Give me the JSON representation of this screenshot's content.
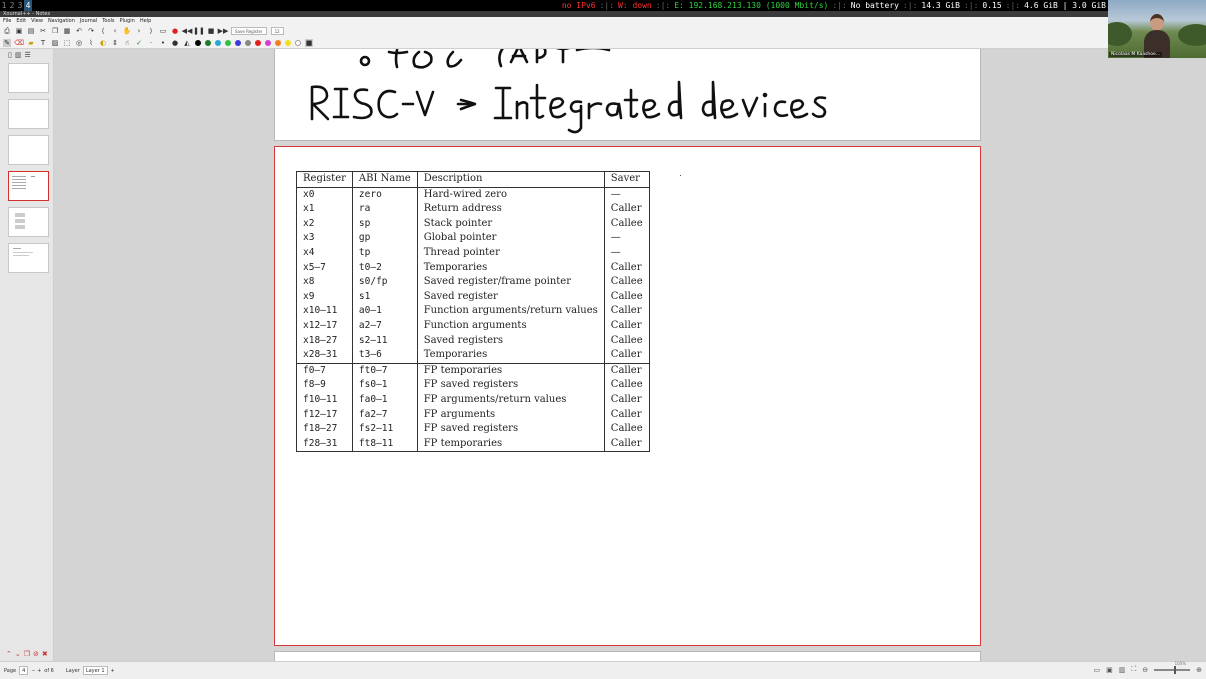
{
  "statusbar": {
    "workspaces": [
      "1",
      "2",
      "3",
      "4"
    ],
    "active_workspace": "4",
    "ipv6": "no IPv6",
    "wifi": "W: down",
    "ethernet": "E: 192.168.213.130 (1000 Mbit/s)",
    "battery": "No battery",
    "disk": "14.3 GiB",
    "load": "0.15",
    "memory": "4.6 GiB | 3.0 GiB"
  },
  "window": {
    "title": "Xournal++ - Notes"
  },
  "menu": [
    "File",
    "Edit",
    "View",
    "Navigation",
    "Journal",
    "Tools",
    "Plugin",
    "Help"
  ],
  "toolbar": {
    "layer_combo": "Save Register",
    "layer_num": "12"
  },
  "ink_text": {
    "line1": "• iOS (API",
    "line2": "RISC-V → Integrated devices"
  },
  "register_table": {
    "headers": [
      "Register",
      "ABI Name",
      "Description",
      "Saver"
    ],
    "rows": [
      [
        "x0",
        "zero",
        "Hard-wired zero",
        "—"
      ],
      [
        "x1",
        "ra",
        "Return address",
        "Caller"
      ],
      [
        "x2",
        "sp",
        "Stack pointer",
        "Callee"
      ],
      [
        "x3",
        "gp",
        "Global pointer",
        "—"
      ],
      [
        "x4",
        "tp",
        "Thread pointer",
        "—"
      ],
      [
        "x5–7",
        "t0–2",
        "Temporaries",
        "Caller"
      ],
      [
        "x8",
        "s0/fp",
        "Saved register/frame pointer",
        "Callee"
      ],
      [
        "x9",
        "s1",
        "Saved register",
        "Callee"
      ],
      [
        "x10–11",
        "a0–1",
        "Function arguments/return values",
        "Caller"
      ],
      [
        "x12–17",
        "a2–7",
        "Function arguments",
        "Caller"
      ],
      [
        "x18–27",
        "s2–11",
        "Saved registers",
        "Callee"
      ],
      [
        "x28–31",
        "t3–6",
        "Temporaries",
        "Caller"
      ],
      [
        "f0–7",
        "ft0–7",
        "FP temporaries",
        "Caller"
      ],
      [
        "f8–9",
        "fs0–1",
        "FP saved registers",
        "Callee"
      ],
      [
        "f10–11",
        "fa0–1",
        "FP arguments/return values",
        "Caller"
      ],
      [
        "f12–17",
        "fa2–7",
        "FP arguments",
        "Caller"
      ],
      [
        "f18–27",
        "fs2–11",
        "FP saved registers",
        "Callee"
      ],
      [
        "f28–31",
        "ft8–11",
        "FP temporaries",
        "Caller"
      ]
    ]
  },
  "webcam": {
    "name": "Nicolaas M Kaashoe..."
  },
  "bottombar": {
    "page_label": "Page",
    "page_value": "4",
    "page_of": "of 6",
    "layer_label": "Layer",
    "layer_value": "Layer 1",
    "zoom": "100%"
  },
  "colors": {
    "accent_red": "#d43a3a",
    "workspace_active": "#285577"
  }
}
